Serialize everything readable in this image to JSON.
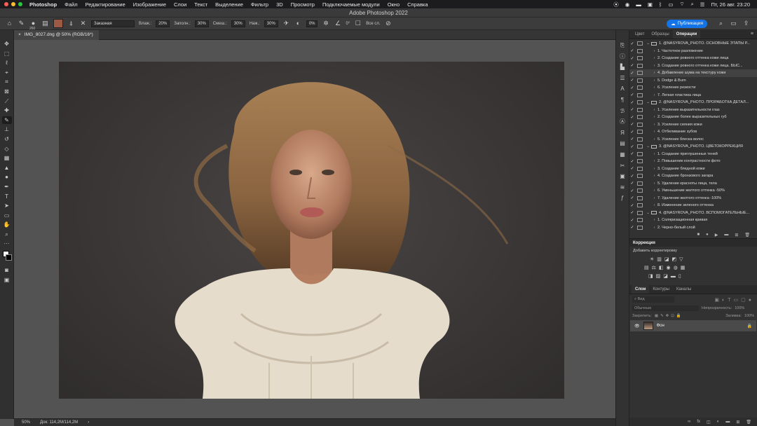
{
  "menubar": {
    "apple": "",
    "items": [
      "Photoshop",
      "Файл",
      "Редактирование",
      "Изображение",
      "Слои",
      "Текст",
      "Выделение",
      "Фильтр",
      "3D",
      "Просмотр",
      "Подключаемые модули",
      "Окно",
      "Справка"
    ],
    "clock": "Пт, 26 авг.  23:20"
  },
  "window": {
    "title": "Adobe Photoshop 2022"
  },
  "options": {
    "brush_size": "260",
    "mode_label": "Заказная",
    "vlazh_label": "Влаж.:",
    "vlazh_value": "20%",
    "zapoln_label": "Заполн.:",
    "zapoln_value": "30%",
    "smesh_label": "Смеш.:",
    "smesh_value": "30%",
    "nazh_label": "Наж.:",
    "nazh_value": "30%",
    "angle_value": "0%",
    "rot_value": "0°",
    "all_layers_label": "Все сл.",
    "publish_label": "Публикация",
    "brush_color": "#9c5a45"
  },
  "document": {
    "tab_label": "IMG_8027.dng @ 50% (RGB/16*)",
    "zoom": "50%",
    "doc_info": "Док: 114,2M/114,2M"
  },
  "panel_tabs": [
    "Цвет",
    "Образцы",
    "Операции"
  ],
  "actions": [
    {
      "level": 0,
      "label": "1. @NASYROVA_PHOTO. ОСНОВНЫЕ ЭТАПЫ Р..."
    },
    {
      "level": 1,
      "label": "1. Частотное разложение"
    },
    {
      "level": 1,
      "label": "2. Создание ровного оттенка кожи лица"
    },
    {
      "level": 1,
      "label": "3. Создание ровного оттенка кожи лица. БЫС..."
    },
    {
      "level": 1,
      "label": "4. Добавление шума на текстуру кожи",
      "selected": true
    },
    {
      "level": 1,
      "label": "5. Dodge & Burn"
    },
    {
      "level": 1,
      "label": "6. Усиление резкости"
    },
    {
      "level": 1,
      "label": "7. Легкая пластика лица"
    },
    {
      "level": 0,
      "label": "2. @NASYROVA_PHOTO. ПРОРАБОТКА ДЕТАЛ..."
    },
    {
      "level": 1,
      "label": "1. Усиление выразительности глаз"
    },
    {
      "level": 1,
      "label": "2. Создание более выразительных губ"
    },
    {
      "level": 1,
      "label": "3. Усиление сияния кожи"
    },
    {
      "level": 1,
      "label": "4. Отбеливание зубов"
    },
    {
      "level": 1,
      "label": "5. Усиление блеска волос"
    },
    {
      "level": 0,
      "label": "3. @NASYROVA_PHOTO. ЦВЕТОКОРРЕКЦИЯ"
    },
    {
      "level": 1,
      "label": "1. Создание приглушенных теней"
    },
    {
      "level": 1,
      "label": "2. Повышение контрастности фото"
    },
    {
      "level": 1,
      "label": "3. Создание бледной кожи"
    },
    {
      "level": 1,
      "label": "4. Создание бронзового загара"
    },
    {
      "level": 1,
      "label": "5. Удаление красноты лица, тела"
    },
    {
      "level": 1,
      "label": "6. Уменьшение желтого оттенка -50%"
    },
    {
      "level": 1,
      "label": "7. Удаление желтого оттенка -100%"
    },
    {
      "level": 1,
      "label": "8. Изменение зеленого оттенка"
    },
    {
      "level": 0,
      "label": "4. @NASYROVA_PHOTO. ВСПОМОГАТЕЛЬНЫЕ..."
    },
    {
      "level": 1,
      "label": "1. Соляризационная кривая"
    },
    {
      "level": 1,
      "label": "2. Черно-белый слой"
    }
  ],
  "correction": {
    "title": "Коррекция",
    "subtitle": "Добавить корректировку"
  },
  "layers": {
    "tabs": [
      "Слои",
      "Контуры",
      "Каналы"
    ],
    "search_placeholder": "Вид",
    "blend_mode": "Обычные",
    "opacity_label": "Непрозрачность:",
    "opacity_value": "100%",
    "lock_label": "Закрепить:",
    "fill_label": "Заливка:",
    "fill_value": "100%",
    "layer_name": "Фон"
  }
}
